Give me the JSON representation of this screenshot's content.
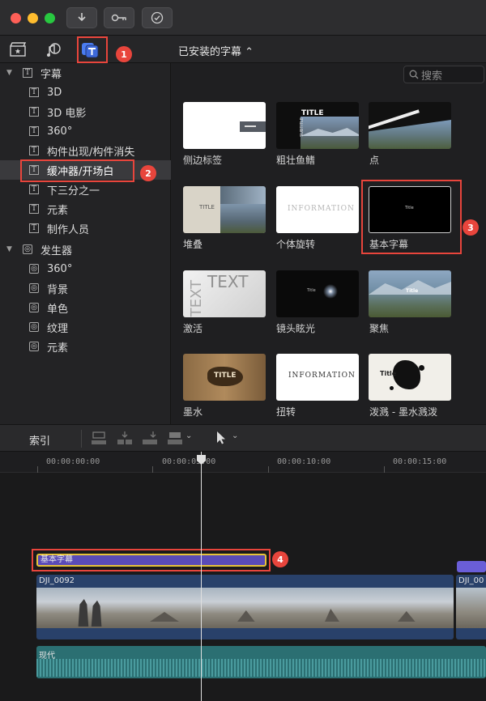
{
  "browser": {
    "dropdown_label": "已安装的字幕 ⌃",
    "search_placeholder": "搜索"
  },
  "sidebar": {
    "titles_group": "字幕",
    "title_items": [
      "3D",
      "3D 电影",
      "360°",
      "构件出现/构件消失",
      "缓冲器/开场白",
      "下三分之一",
      "元素",
      "制作人员"
    ],
    "generators_group": "发生器",
    "generator_items": [
      "360°",
      "背景",
      "单色",
      "纹理",
      "元素"
    ],
    "selected_item": "缓冲器/开场白"
  },
  "grid": {
    "tiles": [
      {
        "label": "侧边标签"
      },
      {
        "label": "粗壮鱼鳍"
      },
      {
        "label": "点"
      },
      {
        "label": "堆叠"
      },
      {
        "label": "个体旋转"
      },
      {
        "label": "基本字幕"
      },
      {
        "label": "激活"
      },
      {
        "label": "镜头眩光"
      },
      {
        "label": "聚焦"
      },
      {
        "label": "墨水"
      },
      {
        "label": "扭转"
      },
      {
        "label": "泼溅 - 墨水溅泼"
      }
    ],
    "thumb_text": {
      "title": "TITLE",
      "subtitle": "SUBTITLE",
      "information": "INFORMATION",
      "title_small": "Title",
      "text_big": "TEXT"
    },
    "selected_tile": "基本字幕"
  },
  "timeline_bar": {
    "index_label": "索引"
  },
  "timeline": {
    "timecodes": [
      "00:00:00:00",
      "00:00:05:00",
      "00:00:10:00",
      "00:00:15:00"
    ],
    "title_clip": "基本字幕",
    "video_clip_1": "DJI_0092",
    "video_clip_2": "DJI_00",
    "audio_clip": "现代"
  },
  "annotations": [
    "1",
    "2",
    "3",
    "4"
  ],
  "colors": {
    "accent_blue": "#4a7cf0",
    "annotation_red": "#e8453c",
    "title_clip_purple": "#5a4bb8",
    "selection_yellow": "#e7c33a",
    "video_blue": "#29416a",
    "audio_teal": "#2b6f72"
  }
}
